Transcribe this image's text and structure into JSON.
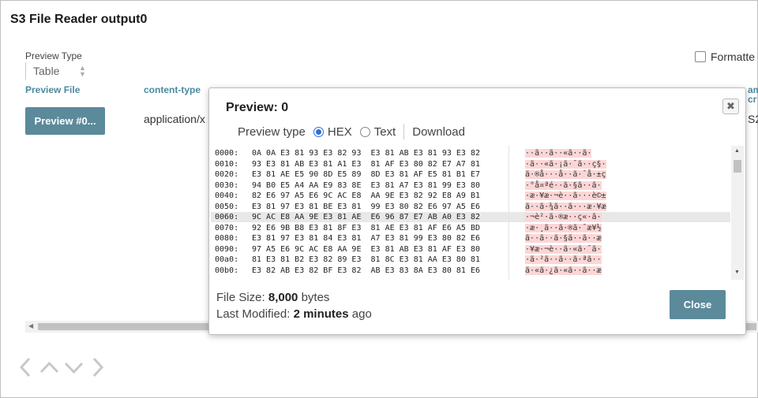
{
  "window": {
    "title": "S3 File Reader output0"
  },
  "preview_type": {
    "label": "Preview Type",
    "value": "Table"
  },
  "formatted": {
    "label": "Formatte"
  },
  "columns": [
    "Preview File",
    "content-type",
    "am",
    "cr"
  ],
  "row": {
    "button_label": "Preview #0...",
    "content_type": "application/x",
    "trailing": "S2"
  },
  "modal": {
    "title": "Preview: 0",
    "close_x": "✖",
    "preview_type_label": "Preview type",
    "option_hex": "HEX",
    "option_text": "Text",
    "download": "Download",
    "hex_rows": [
      {
        "offset": "0000:",
        "bytes": "0A 0A E3 81 93 E3 82 93  E3 81 AB E3 81 93 E3 82",
        "chars": "··ã··ã··«ã··ã·"
      },
      {
        "offset": "0010:",
        "bytes": "93 E3 81 AB E3 81 A1 E3  81 AF E3 80 82 E7 A7 81",
        "chars": "·ã··«ã·¡ã·¯ã··ç§·"
      },
      {
        "offset": "0020:",
        "bytes": "E3 81 AE E5 90 8D E5 89  8D E3 81 AF E5 81 B1 E7",
        "chars": "ã·®å···å··ã·¯å·±ç"
      },
      {
        "offset": "0030:",
        "bytes": "94 B0 E5 A4 AA E9 83 8E  E3 81 A7 E3 81 99 E3 80",
        "chars": "·°å¤ªé··ã·§ã··ã·"
      },
      {
        "offset": "0040:",
        "bytes": "82 E6 97 A5 E6 9C AC E8  AA 9E E3 82 92 E8 A9 B1",
        "chars": "·æ·¥æ·¬è··ã···è©±"
      },
      {
        "offset": "0050:",
        "bytes": "E3 81 97 E3 81 BE E3 81  99 E3 80 82 E6 97 A5 E6",
        "chars": "ã··ã·¾ã··ã···æ·¥æ"
      },
      {
        "offset": "0060:",
        "bytes": "9C AC E8 AA 9E E3 81 AE  E6 96 87 E7 AB A0 E3 82",
        "chars": "·¬è²·ã·®æ··ç«·ã·"
      },
      {
        "offset": "0070:",
        "bytes": "92 E6 9B B8 E3 81 8F E3  81 AE E3 81 AF E6 A5 BD",
        "chars": "·æ·¸ã··ã·®ã·¯æ¥½"
      },
      {
        "offset": "0080:",
        "bytes": "E3 81 97 E3 81 84 E3 81  A7 E3 81 99 E3 80 82 E6",
        "chars": "ã··ã··ã·§ã··ã··æ"
      },
      {
        "offset": "0090:",
        "bytes": "97 A5 E6 9C AC E8 AA 9E  E3 81 AB E3 81 AF E3 80",
        "chars": "·¥æ·¬è··ã·«ã·¯ã·"
      },
      {
        "offset": "00a0:",
        "bytes": "81 E3 81 B2 E3 82 89 E3  81 8C E3 81 AA E3 80 81",
        "chars": "·ã·²ã··ã··ã·ªã··"
      },
      {
        "offset": "00b0:",
        "bytes": "E3 82 AB E3 82 BF E3 82  AB E3 83 8A E3 80 81 E6",
        "chars": "ã·«ã·¿ã·«ã··ã··æ"
      }
    ],
    "file_size_label": "File Size:",
    "file_size_value": "8,000",
    "file_size_unit": "bytes",
    "last_modified_label": "Last Modified:",
    "last_modified_value": "2 minutes",
    "last_modified_suffix": "ago",
    "close_label": "Close"
  },
  "colors": {
    "accent": "#5b8a9a",
    "header_text": "#4c8aa0",
    "radio": "#2f6fd9"
  }
}
